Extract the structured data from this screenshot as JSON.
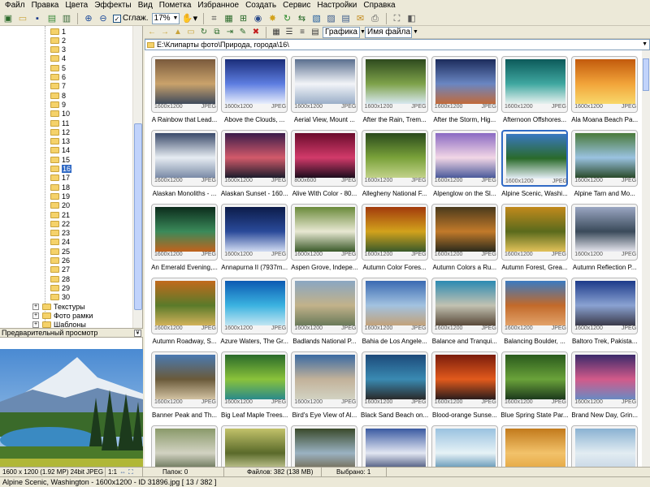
{
  "menu": [
    "Файл",
    "Правка",
    "Цвета",
    "Эффекты",
    "Вид",
    "Пометка",
    "Избранное",
    "Создать",
    "Сервис",
    "Настройки",
    "Справка"
  ],
  "toolbar": {
    "smooth_label": "Сглаж.",
    "zoom_value": "17%"
  },
  "nav": {
    "view_mode": "Графика",
    "sort_mode": "Имя файла"
  },
  "path": "E:\\Клипарты фото\\Природа, города\\16\\",
  "tree": {
    "numbers": [
      "1",
      "2",
      "3",
      "4",
      "5",
      "6",
      "7",
      "8",
      "9",
      "10",
      "11",
      "12",
      "13",
      "14",
      "15",
      "16",
      "17",
      "18",
      "19",
      "20",
      "21",
      "22",
      "23",
      "24",
      "25",
      "26",
      "27",
      "28",
      "29",
      "30"
    ],
    "selected": "16",
    "folders": [
      "Текстуры",
      "Фото рамки",
      "Шаблоны"
    ]
  },
  "preview": {
    "title": "Предварительный просмотр"
  },
  "thumbnails": [
    {
      "name": "A Rainbow that Lead...",
      "dims": "1600x1200",
      "fmt": "JPEG",
      "colors": [
        "#7a5a3c",
        "#c9a26b",
        "#3f4a5c"
      ]
    },
    {
      "name": "Above the Clouds, ...",
      "dims": "1600x1200",
      "fmt": "JPEG",
      "colors": [
        "#1b2e7a",
        "#5d7de0",
        "#e8eefc"
      ]
    },
    {
      "name": "Aerial View, Mount ...",
      "dims": "1600x1200",
      "fmt": "JPEG",
      "colors": [
        "#5a6f8f",
        "#f2f4f8",
        "#9aaec8"
      ]
    },
    {
      "name": "After the Rain, Trem...",
      "dims": "1600x1200",
      "fmt": "JPEG",
      "colors": [
        "#2e4a1e",
        "#7ea24a",
        "#d8e8f0"
      ]
    },
    {
      "name": "After the Storm, Hig...",
      "dims": "1600x1200",
      "fmt": "JPEG",
      "colors": [
        "#1c2c5c",
        "#6a86c2",
        "#c26a3a"
      ]
    },
    {
      "name": "Afternoon Offshores...",
      "dims": "1600x1200",
      "fmt": "JPEG",
      "colors": [
        "#0c5a5a",
        "#3fa7a0",
        "#e8f2f0"
      ]
    },
    {
      "name": "Ala Moana Beach Pa...",
      "dims": "1600x1200",
      "fmt": "JPEG",
      "colors": [
        "#c25a0c",
        "#f2a43a",
        "#f8d86a"
      ]
    },
    {
      "name": "Alaskan Monoliths - ...",
      "dims": "1600x1200",
      "fmt": "JPEG",
      "colors": [
        "#3a4a6a",
        "#e6ecf2",
        "#7a8aa6"
      ]
    },
    {
      "name": "Alaskan Sunset - 160...",
      "dims": "1600x1200",
      "fmt": "JPEG",
      "colors": [
        "#3a1c4a",
        "#d25a6a",
        "#1c1c2c"
      ]
    },
    {
      "name": "Alive With Color - 80...",
      "dims": "800x600",
      "fmt": "JPEG",
      "colors": [
        "#6a0c2c",
        "#d23a6a",
        "#1c0c1c"
      ]
    },
    {
      "name": "Allegheny National F...",
      "dims": "1600x1200",
      "fmt": "JPEG",
      "colors": [
        "#2a4a1c",
        "#7aa23a",
        "#c2d28a"
      ]
    },
    {
      "name": "Alpenglow on the Sl...",
      "dims": "1600x1200",
      "fmt": "JPEG",
      "colors": [
        "#8a6ac2",
        "#f2d6e6",
        "#4a5a9a"
      ]
    },
    {
      "name": "Alpine Scenic, Washi...",
      "dims": "1600x1200",
      "fmt": "JPEG",
      "colors": [
        "#3a78c2",
        "#2a6a2a",
        "#e6eef6"
      ]
    },
    {
      "name": "Alpine Tarn and Mo...",
      "dims": "1600x1200",
      "fmt": "JPEG",
      "colors": [
        "#4a7a3a",
        "#9ac2e0",
        "#2a4a2a"
      ]
    },
    {
      "name": "An Emerald Evening,...",
      "dims": "1600x1200",
      "fmt": "JPEG",
      "colors": [
        "#0c2c1c",
        "#3a8a5a",
        "#c2621c"
      ]
    },
    {
      "name": "Annapurna II (7937m...",
      "dims": "1600x1200",
      "fmt": "JPEG",
      "colors": [
        "#0c1c4a",
        "#2a4a9a",
        "#d2dcf2"
      ]
    },
    {
      "name": "Aspen Grove, Indepe...",
      "dims": "1600x1200",
      "fmt": "JPEG",
      "colors": [
        "#6a8a3a",
        "#e8e8d2",
        "#3a5a2a"
      ]
    },
    {
      "name": "Autumn Color Fores...",
      "dims": "1600x1200",
      "fmt": "JPEG",
      "colors": [
        "#a23a0c",
        "#d2a21c",
        "#3a5a2a"
      ]
    },
    {
      "name": "Autumn Colors a Ru...",
      "dims": "1600x1200",
      "fmt": "JPEG",
      "colors": [
        "#4a3a1c",
        "#c27a2a",
        "#2a2a1c"
      ]
    },
    {
      "name": "Autumn Forest, Grea...",
      "dims": "1600x1200",
      "fmt": "JPEG",
      "colors": [
        "#c28a1c",
        "#5a6a1c",
        "#e2c25a"
      ]
    },
    {
      "name": "Autumn Reflection P...",
      "dims": "1600x1200",
      "fmt": "JPEG",
      "colors": [
        "#9aa6c2",
        "#3a4a5a",
        "#e6e6ee"
      ]
    },
    {
      "name": "Autumn Roadway, S...",
      "dims": "1600x1200",
      "fmt": "JPEG",
      "colors": [
        "#c26a1c",
        "#5a7a2a",
        "#d2b25a"
      ]
    },
    {
      "name": "Azure Waters, The Gr...",
      "dims": "1600x1200",
      "fmt": "JPEG",
      "colors": [
        "#0c5ab2",
        "#3ab2e0",
        "#c2e6f2"
      ]
    },
    {
      "name": "Badlands National P...",
      "dims": "1600x1200",
      "fmt": "JPEG",
      "colors": [
        "#8aa6c2",
        "#c2b28a",
        "#6a7a5a"
      ]
    },
    {
      "name": "Bahia de Los Angele...",
      "dims": "1600x1200",
      "fmt": "JPEG",
      "colors": [
        "#3a6ab2",
        "#a2c2e0",
        "#c2a27a"
      ]
    },
    {
      "name": "Balance and Tranqui...",
      "dims": "1600x1200",
      "fmt": "JPEG",
      "colors": [
        "#2a8ab2",
        "#c2c2b2",
        "#5a4a3a"
      ]
    },
    {
      "name": "Balancing Boulder, ...",
      "dims": "1600x1200",
      "fmt": "JPEG",
      "colors": [
        "#3a7ac2",
        "#c26a2a",
        "#e2a26a"
      ]
    },
    {
      "name": "Baltoro Trek, Pakista...",
      "dims": "1600x1200",
      "fmt": "JPEG",
      "colors": [
        "#1c3a8a",
        "#8aa2d2",
        "#3a3a4a"
      ]
    },
    {
      "name": "Banner Peak and Th...",
      "dims": "1600x1200",
      "fmt": "JPEG",
      "colors": [
        "#4a7ab2",
        "#6a5a3a",
        "#d2c2a2"
      ]
    },
    {
      "name": "Big Leaf Maple Trees...",
      "dims": "1600x1200",
      "fmt": "JPEG",
      "colors": [
        "#2a6a2a",
        "#8ac23a",
        "#2a8a8a"
      ]
    },
    {
      "name": "Bird's Eye View of Al...",
      "dims": "1600x1200",
      "fmt": "JPEG",
      "colors": [
        "#3a6aa2",
        "#c2b29a",
        "#d2d2c2"
      ]
    },
    {
      "name": "Black Sand Beach on...",
      "dims": "1600x1200",
      "fmt": "JPEG",
      "colors": [
        "#1c4a7a",
        "#3a8ab2",
        "#2a2a2a"
      ]
    },
    {
      "name": "Blood-orange Sunse...",
      "dims": "1600x1200",
      "fmt": "JPEG",
      "colors": [
        "#7a1c0c",
        "#e25a1c",
        "#2a1c1c"
      ]
    },
    {
      "name": "Blue Spring State Par...",
      "dims": "1600x1200",
      "fmt": "JPEG",
      "colors": [
        "#2a5a1c",
        "#6aa23a",
        "#1c3a1c"
      ]
    },
    {
      "name": "Brand New Day, Grin...",
      "dims": "1600x1200",
      "fmt": "JPEG",
      "colors": [
        "#3a2a6a",
        "#d25a8a",
        "#6a8ac2"
      ]
    },
    {
      "name": "",
      "dims": "",
      "fmt": "",
      "colors": [
        "#8a9a6a",
        "#d2d2c2",
        "#4a5a3a"
      ]
    },
    {
      "name": "",
      "dims": "",
      "fmt": "",
      "colors": [
        "#c2c26a",
        "#5a6a2a",
        "#e2e2b2"
      ]
    },
    {
      "name": "",
      "dims": "",
      "fmt": "",
      "colors": [
        "#3a4a2a",
        "#9ab2c2",
        "#6a5a3a"
      ]
    },
    {
      "name": "",
      "dims": "",
      "fmt": "",
      "colors": [
        "#3a5aa2",
        "#e2e6f2",
        "#1c2c5a"
      ]
    },
    {
      "name": "",
      "dims": "",
      "fmt": "",
      "colors": [
        "#9ac2e0",
        "#e6f2f6",
        "#3a7aa2"
      ]
    },
    {
      "name": "",
      "dims": "",
      "fmt": "",
      "colors": [
        "#c27a1c",
        "#f2c26a",
        "#e2a23a"
      ]
    },
    {
      "name": "",
      "dims": "",
      "fmt": "",
      "colors": [
        "#8ab2d2",
        "#e2ecf2",
        "#c2d2e2"
      ]
    }
  ],
  "status": {
    "preview_info": "1600 x 1200 (1.92 MP)   24bit   JPEG   454 K",
    "ratio": "1:1",
    "folders": "Папок: 0",
    "files": "Файлов: 382 (138 MB)",
    "selected": "Выбрано: 1",
    "file_line": "Alpine Scenic, Washington - 1600x1200 - ID 31896.jpg [ 13 / 382 ]"
  }
}
